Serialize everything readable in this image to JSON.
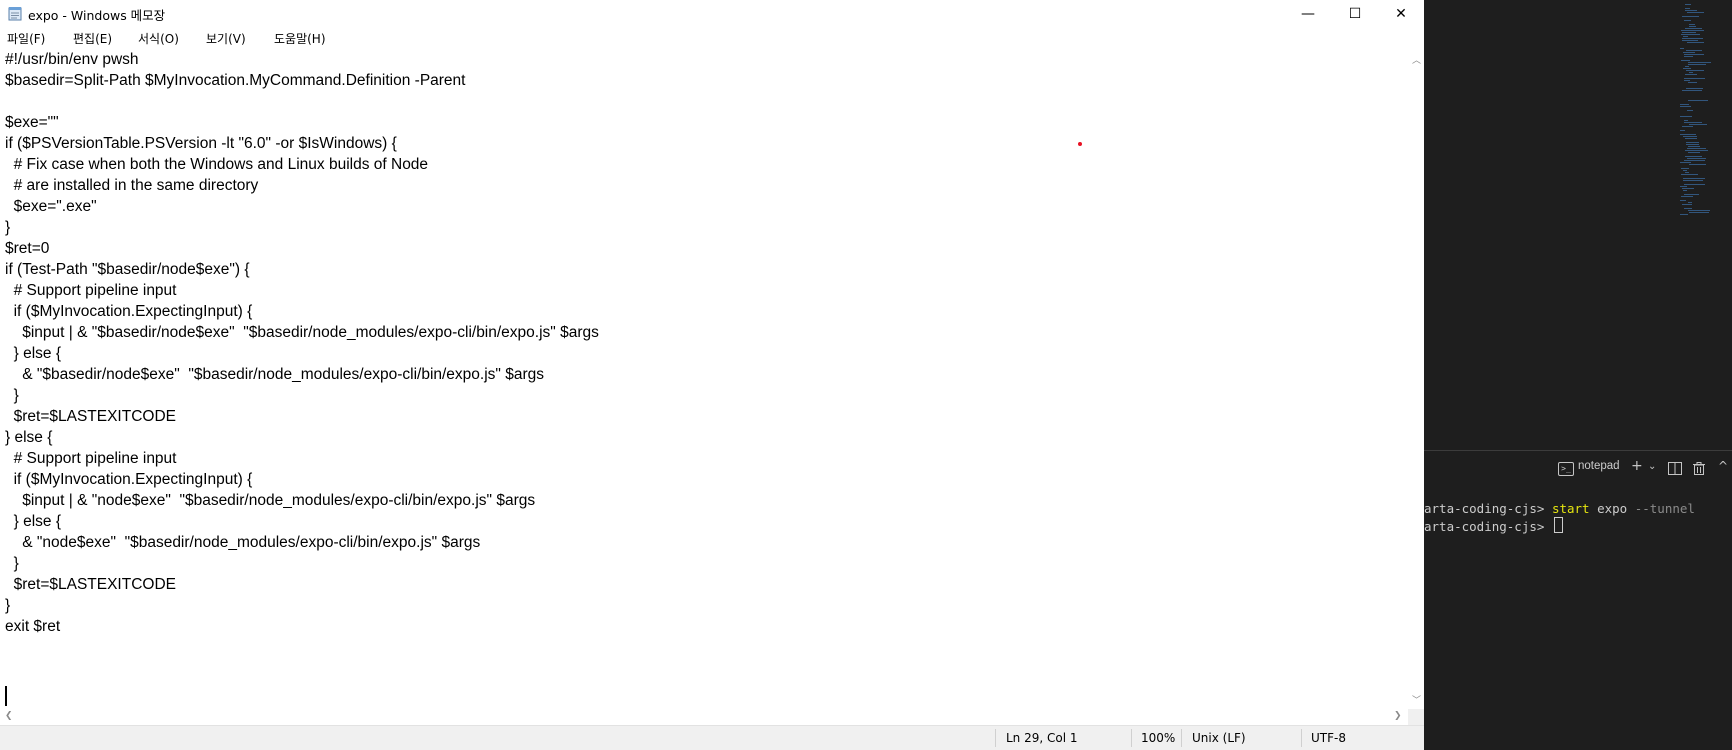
{
  "notepad": {
    "title": "expo - Windows 메모장",
    "window_buttons": {
      "minimize": "—",
      "maximize": "☐",
      "close": "✕"
    },
    "menu": [
      "파일(F)",
      "편집(E)",
      "서식(O)",
      "보기(V)",
      "도움말(H)"
    ],
    "content_lines": [
      "#!/usr/bin/env pwsh",
      "$basedir=Split-Path $MyInvocation.MyCommand.Definition -Parent",
      "",
      "$exe=\"\"",
      "if ($PSVersionTable.PSVersion -lt \"6.0\" -or $IsWindows) {",
      "  # Fix case when both the Windows and Linux builds of Node",
      "  # are installed in the same directory",
      "  $exe=\".exe\"",
      "}",
      "$ret=0",
      "if (Test-Path \"$basedir/node$exe\") {",
      "  # Support pipeline input",
      "  if ($MyInvocation.ExpectingInput) {",
      "    $input | & \"$basedir/node$exe\"  \"$basedir/node_modules/expo-cli/bin/expo.js\" $args",
      "  } else {",
      "    & \"$basedir/node$exe\"  \"$basedir/node_modules/expo-cli/bin/expo.js\" $args",
      "  }",
      "  $ret=$LASTEXITCODE",
      "} else {",
      "  # Support pipeline input",
      "  if ($MyInvocation.ExpectingInput) {",
      "    $input | & \"node$exe\"  \"$basedir/node_modules/expo-cli/bin/expo.js\" $args",
      "  } else {",
      "    & \"node$exe\"  \"$basedir/node_modules/expo-cli/bin/expo.js\" $args",
      "  }",
      "  $ret=$LASTEXITCODE",
      "}",
      "exit $ret",
      ""
    ],
    "status": {
      "position": "Ln 29, Col 1",
      "zoom": "100%",
      "line_ending": "Unix (LF)",
      "encoding": "UTF-8"
    }
  },
  "terminal": {
    "name": "notepad",
    "lines": [
      {
        "prompt": "arta-coding-cjs> ",
        "cmd": "start",
        "arg1": " expo ",
        "arg2": "--tunnel"
      },
      {
        "prompt": "arta-coding-cjs> ",
        "cmd": "",
        "arg1": "",
        "arg2": ""
      }
    ]
  },
  "colors": {
    "accent_red": "#e81123",
    "terminal_command": "#e5e510",
    "terminal_flag": "#8a8a8a"
  },
  "icons": [
    "notepad-app-icon",
    "terminal-icon",
    "plus-icon",
    "chevron-down-icon",
    "split-icon",
    "trash-icon",
    "chevron-up-icon"
  ]
}
